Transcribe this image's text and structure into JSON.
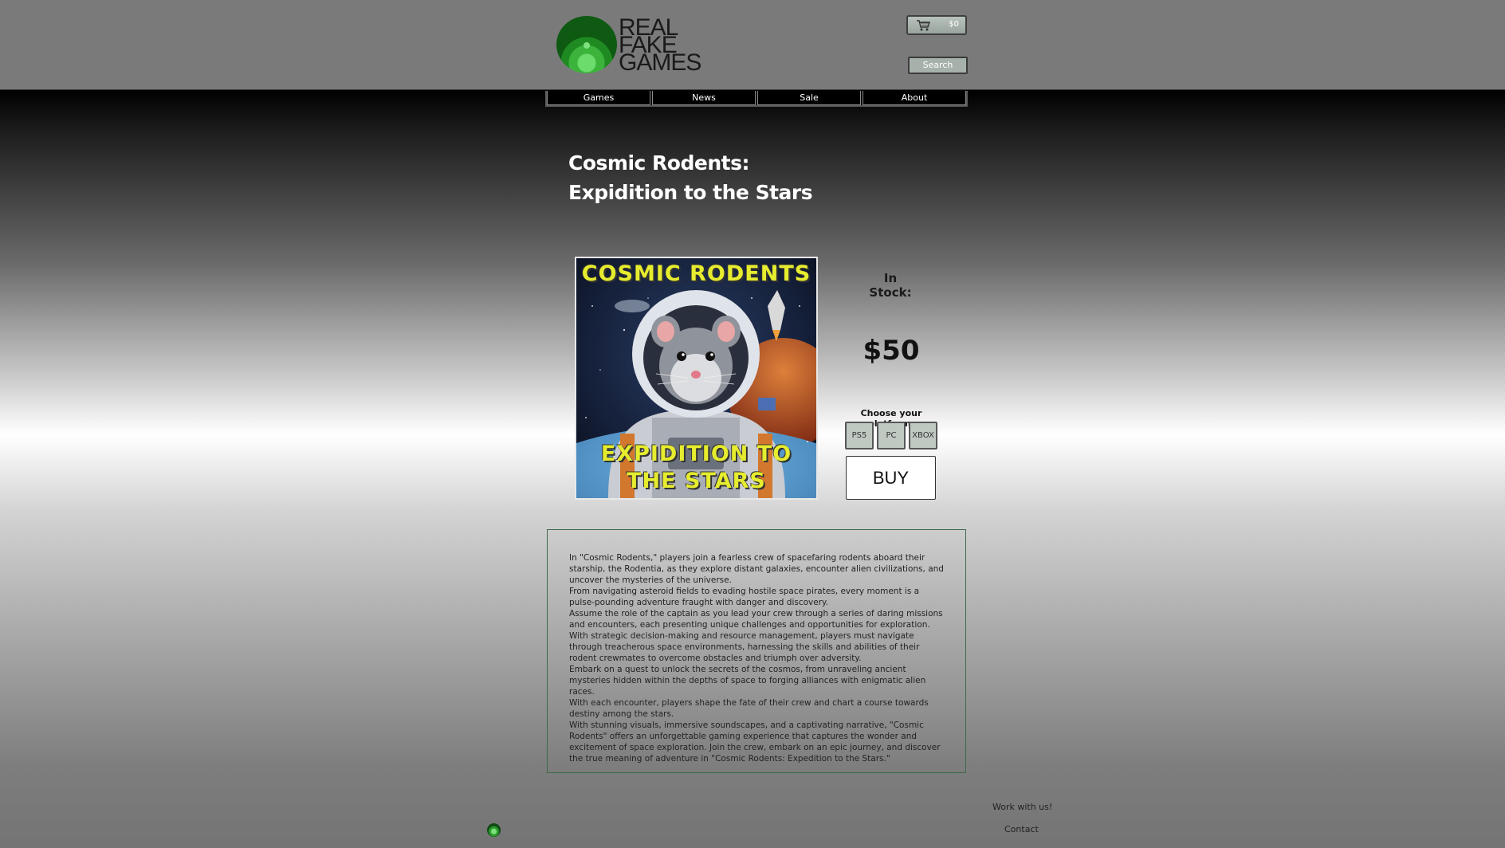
{
  "header": {
    "logo_lines": [
      "REAL",
      "FAKE",
      "GAMES"
    ],
    "cart_amount": "$0",
    "search_label": "Search"
  },
  "nav": {
    "items": [
      {
        "label": "Games"
      },
      {
        "label": "News"
      },
      {
        "label": "Sale"
      },
      {
        "label": "About"
      }
    ]
  },
  "product": {
    "title_line1": "Cosmic Rodents:",
    "title_line2": "Expidition to the Stars",
    "cover_title": "COSMIC RODENTS",
    "cover_subtitle_line1": "EXPIDITION TO",
    "cover_subtitle_line2": "THE STARS",
    "stock_label": "In Stock:",
    "price": "$50",
    "platform_label": "Choose your platform:",
    "platforms": [
      "PS5",
      "PC",
      "XBOX"
    ],
    "buy_label": "BUY"
  },
  "description": [
    "In \"Cosmic Rodents,\" players join a fearless crew of spacefaring rodents aboard their starship, the Rodentia, as they explore distant galaxies, encounter alien civilizations, and uncover the mysteries of the universe.",
    "From navigating asteroid fields to evading hostile space pirates, every moment is a pulse-pounding adventure fraught with danger and discovery.",
    "Assume the role of the captain as you lead your crew through a series of daring missions and encounters, each presenting unique challenges and opportunities for exploration.",
    "With strategic decision-making and resource management, players must navigate through treacherous space environments, harnessing the skills and abilities of their rodent crewmates to overcome obstacles and triumph over adversity.",
    "Embark on a quest to unlock the secrets of the cosmos, from unraveling ancient mysteries hidden within the depths of space to forging alliances with enigmatic alien races.",
    "With each encounter, players shape the fate of their crew and chart a course towards destiny among the stars.",
    "With stunning visuals, immersive soundscapes, and a captivating narrative, \"Cosmic Rodents\" offers an unforgettable gaming experience that captures the wonder and excitement of space exploration. Join the crew, embark on an epic journey, and discover the true meaning of adventure in \"Cosmic Rodents: Expedition to the Stars.\""
  ],
  "footer": {
    "work_with_us": "Work with us!",
    "contact": "Contact"
  },
  "colors": {
    "accent_green": "#2d9a2d",
    "cover_text_yellow": "#e6ec2e"
  }
}
